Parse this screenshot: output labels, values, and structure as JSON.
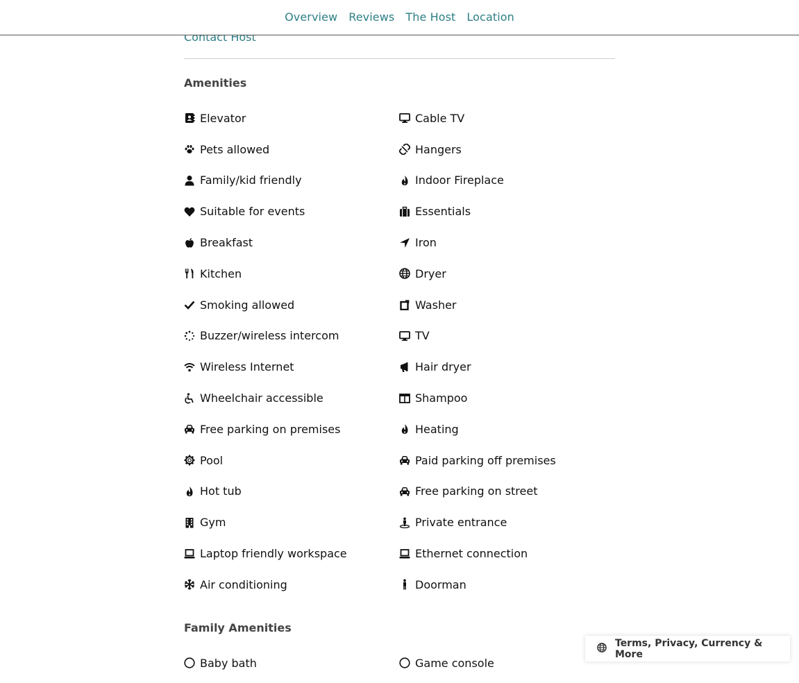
{
  "nav": {
    "links": [
      "Overview",
      "Reviews",
      "The Host",
      "Location"
    ]
  },
  "contact_host": "Contact Host",
  "amenities": {
    "title": "Amenities",
    "items": [
      {
        "label": "Elevator",
        "icon": "address-book-icon"
      },
      {
        "label": "Cable TV",
        "icon": "desktop-icon"
      },
      {
        "label": "Pets allowed",
        "icon": "paw-icon"
      },
      {
        "label": "Hangers",
        "icon": "unlink-icon"
      },
      {
        "label": "Family/kid friendly",
        "icon": "user-icon"
      },
      {
        "label": "Indoor Fireplace",
        "icon": "fire-icon"
      },
      {
        "label": "Suitable for events",
        "icon": "heart-icon"
      },
      {
        "label": "Essentials",
        "icon": "suitcase-icon"
      },
      {
        "label": "Breakfast",
        "icon": "apple-icon"
      },
      {
        "label": "Iron",
        "icon": "location-arrow-icon"
      },
      {
        "label": "Kitchen",
        "icon": "utensils-icon"
      },
      {
        "label": "Dryer",
        "icon": "globe-icon"
      },
      {
        "label": "Smoking allowed",
        "icon": "check-icon"
      },
      {
        "label": "Washer",
        "icon": "square-icon"
      },
      {
        "label": "Buzzer/wireless intercom",
        "icon": "spinner-icon"
      },
      {
        "label": "TV",
        "icon": "desktop-icon"
      },
      {
        "label": "Wireless Internet",
        "icon": "wifi-icon"
      },
      {
        "label": "Hair dryer",
        "icon": "bullhorn-icon"
      },
      {
        "label": "Wheelchair accessible",
        "icon": "wheelchair-icon"
      },
      {
        "label": "Shampoo",
        "icon": "columns-icon"
      },
      {
        "label": "Free parking on premises",
        "icon": "car-icon"
      },
      {
        "label": "Heating",
        "icon": "fire-icon"
      },
      {
        "label": "Pool",
        "icon": "gear-icon"
      },
      {
        "label": "Paid parking off premises",
        "icon": "car-icon"
      },
      {
        "label": "Hot tub",
        "icon": "fire-icon"
      },
      {
        "label": "Free parking on street",
        "icon": "car-icon"
      },
      {
        "label": "Gym",
        "icon": "building-icon"
      },
      {
        "label": "Private entrance",
        "icon": "street-view-icon"
      },
      {
        "label": "Laptop friendly workspace",
        "icon": "laptop-icon"
      },
      {
        "label": "Ethernet connection",
        "icon": "laptop-icon"
      },
      {
        "label": "Air conditioning",
        "icon": "snowflake-icon"
      },
      {
        "label": "Doorman",
        "icon": "male-icon"
      }
    ]
  },
  "family_amenities": {
    "title": "Family Amenities",
    "items": [
      {
        "label": "Baby bath",
        "icon": "circle-icon"
      },
      {
        "label": "Game console",
        "icon": "circle-icon"
      }
    ]
  },
  "footer": {
    "label": "Terms, Privacy, Currency & More",
    "icon": "globe-icon"
  }
}
